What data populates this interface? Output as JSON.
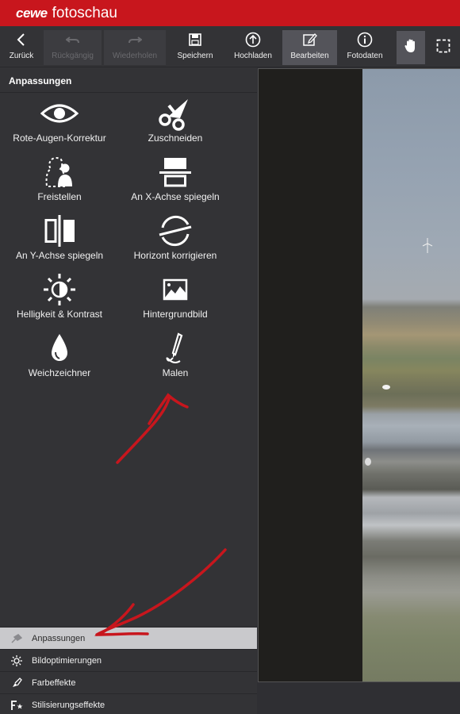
{
  "app": {
    "brand": "cewe",
    "name": "fotoschau"
  },
  "toolbar": {
    "back": "Zurück",
    "undo": "Rückgängig",
    "redo": "Wiederholen",
    "save": "Speichern",
    "upload": "Hochladen",
    "edit": "Bearbeiten",
    "photo_data": "Fotodaten"
  },
  "sidebar": {
    "heading": "Anpassungen",
    "tools": [
      {
        "label": "Rote-Augen-Korrektur",
        "icon": "eye-icon"
      },
      {
        "label": "Zuschneiden",
        "icon": "scissors-icon"
      },
      {
        "label": "Freistellen",
        "icon": "cutout-person-icon"
      },
      {
        "label": "An X-Achse spiegeln",
        "icon": "mirror-x-icon"
      },
      {
        "label": "An Y-Achse spiegeln",
        "icon": "mirror-y-icon"
      },
      {
        "label": "Horizont korrigieren",
        "icon": "horizon-icon"
      },
      {
        "label": "Helligkeit & Kontrast",
        "icon": "brightness-icon"
      },
      {
        "label": "Hintergrundbild",
        "icon": "background-image-icon"
      },
      {
        "label": "Weichzeichner",
        "icon": "drop-icon"
      },
      {
        "label": "Malen",
        "icon": "brush-icon"
      }
    ],
    "categories": [
      {
        "label": "Anpassungen",
        "active": true
      },
      {
        "label": "Bildoptimierungen",
        "active": false
      },
      {
        "label": "Farbeffekte",
        "active": false
      },
      {
        "label": "Stilisierungseffekte",
        "active": false
      }
    ]
  },
  "colors": {
    "brand_red": "#c8161d",
    "panel": "#333336",
    "annotation_red": "#c8161d"
  }
}
